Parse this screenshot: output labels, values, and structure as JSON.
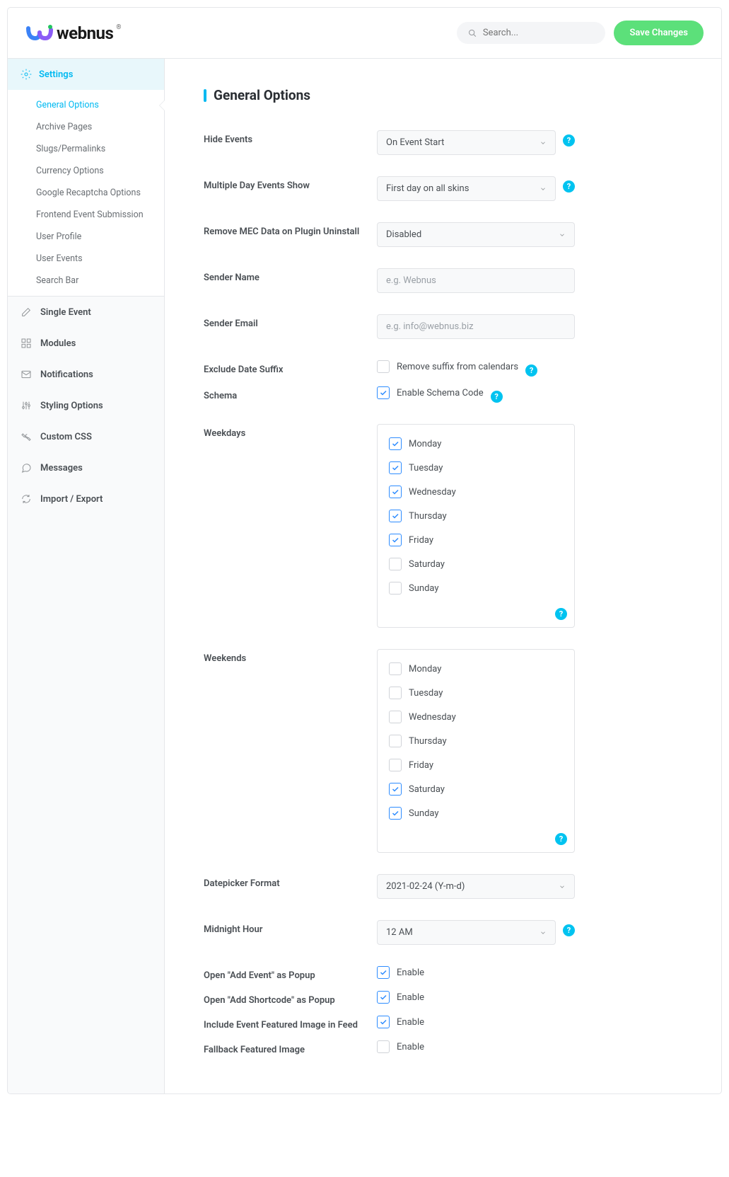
{
  "header": {
    "brand": "webnus",
    "search_placeholder": "Search...",
    "save_label": "Save Changes"
  },
  "sidebar": {
    "settings_label": "Settings",
    "settings_subs": [
      {
        "label": "General Options",
        "active": true
      },
      {
        "label": "Archive Pages"
      },
      {
        "label": "Slugs/Permalinks"
      },
      {
        "label": "Currency Options"
      },
      {
        "label": "Google Recaptcha Options"
      },
      {
        "label": "Frontend Event Submission"
      },
      {
        "label": "User Profile"
      },
      {
        "label": "User Events"
      },
      {
        "label": "Search Bar"
      }
    ],
    "items": [
      {
        "label": "Single Event",
        "icon": "edit"
      },
      {
        "label": "Modules",
        "icon": "grid"
      },
      {
        "label": "Notifications",
        "icon": "mail"
      },
      {
        "label": "Styling Options",
        "icon": "sliders"
      },
      {
        "label": "Custom CSS",
        "icon": "wrench"
      },
      {
        "label": "Messages",
        "icon": "chat"
      },
      {
        "label": "Import / Export",
        "icon": "refresh"
      }
    ]
  },
  "page": {
    "title": "General Options",
    "fields": {
      "hide_events": {
        "label": "Hide Events",
        "value": "On Event Start",
        "help": true
      },
      "multiday": {
        "label": "Multiple Day Events Show",
        "value": "First day on all skins",
        "help": true
      },
      "remove_data": {
        "label": "Remove MEC Data on Plugin Uninstall",
        "value": "Disabled"
      },
      "sender_name": {
        "label": "Sender Name",
        "placeholder": "e.g. Webnus"
      },
      "sender_email": {
        "label": "Sender Email",
        "placeholder": "e.g. info@webnus.biz"
      },
      "exclude_suffix": {
        "label": "Exclude Date Suffix",
        "check_label": "Remove suffix from calendars",
        "checked": false,
        "help": true
      },
      "schema": {
        "label": "Schema",
        "check_label": "Enable Schema Code",
        "checked": true,
        "help": true
      },
      "weekdays": {
        "label": "Weekdays",
        "days": [
          {
            "label": "Monday",
            "checked": true
          },
          {
            "label": "Tuesday",
            "checked": true
          },
          {
            "label": "Wednesday",
            "checked": true
          },
          {
            "label": "Thursday",
            "checked": true
          },
          {
            "label": "Friday",
            "checked": true
          },
          {
            "label": "Saturday",
            "checked": false
          },
          {
            "label": "Sunday",
            "checked": false
          }
        ]
      },
      "weekends": {
        "label": "Weekends",
        "days": [
          {
            "label": "Monday",
            "checked": false
          },
          {
            "label": "Tuesday",
            "checked": false
          },
          {
            "label": "Wednesday",
            "checked": false
          },
          {
            "label": "Thursday",
            "checked": false
          },
          {
            "label": "Friday",
            "checked": false
          },
          {
            "label": "Saturday",
            "checked": true
          },
          {
            "label": "Sunday",
            "checked": true
          }
        ]
      },
      "datepicker": {
        "label": "Datepicker Format",
        "value": "2021-02-24 (Y-m-d)"
      },
      "midnight": {
        "label": "Midnight Hour",
        "value": "12 AM",
        "help": true
      },
      "popup_event": {
        "label": "Open \"Add Event\" as Popup",
        "check_label": "Enable",
        "checked": true
      },
      "popup_shortcode": {
        "label": "Open \"Add Shortcode\" as Popup",
        "check_label": "Enable",
        "checked": true
      },
      "featured_feed": {
        "label": "Include Event Featured Image in Feed",
        "check_label": "Enable",
        "checked": true
      },
      "fallback": {
        "label": "Fallback Featured Image",
        "check_label": "Enable",
        "checked": false
      }
    }
  }
}
